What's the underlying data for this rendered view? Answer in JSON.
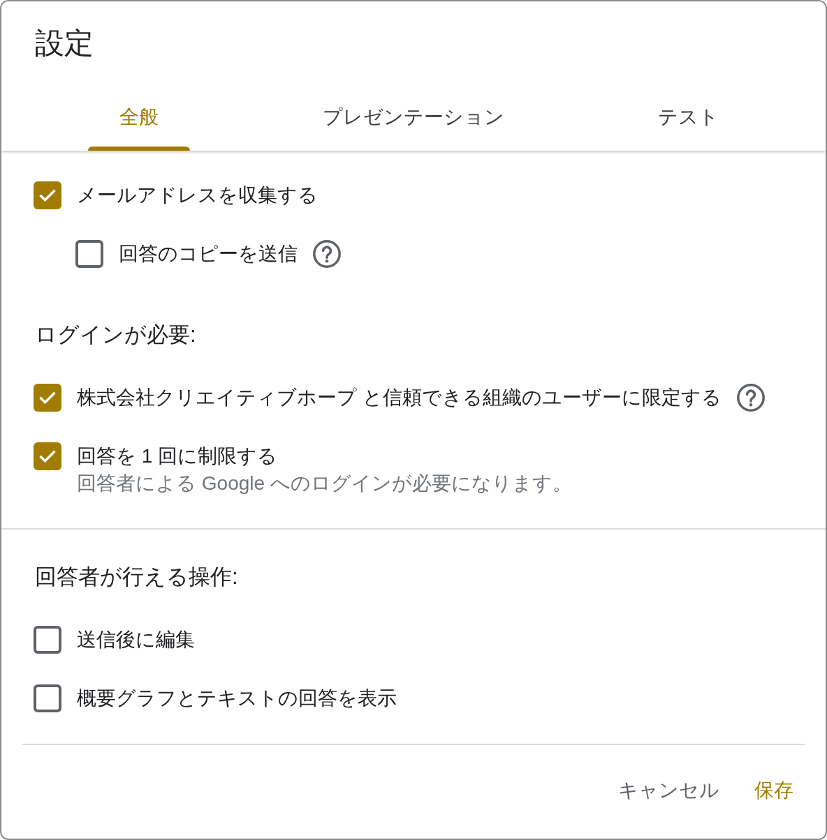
{
  "title": "設定",
  "tabs": [
    {
      "label": "全般",
      "selected": true
    },
    {
      "label": "プレゼンテーション",
      "selected": false
    },
    {
      "label": "テスト",
      "selected": false
    }
  ],
  "sections": [
    {
      "items": [
        {
          "kind": "checkbox",
          "label": "メールアドレスを収集する",
          "checked": true,
          "help": false,
          "children": [
            {
              "kind": "checkbox",
              "label": "回答のコピーを送信",
              "checked": false,
              "help": true
            }
          ]
        },
        {
          "kind": "heading",
          "label": "ログインが必要:"
        },
        {
          "kind": "checkbox",
          "label": "株式会社クリエイティブホープ と信頼できる組織のユーザーに限定する",
          "checked": true,
          "help": true
        },
        {
          "kind": "checkbox",
          "label": "回答を 1 回に制限する",
          "checked": true,
          "help": false,
          "description": "回答者による Google へのログインが必要になります。"
        }
      ]
    },
    {
      "items": [
        {
          "kind": "heading",
          "label": "回答者が行える操作:"
        },
        {
          "kind": "checkbox",
          "label": "送信後に編集",
          "checked": false,
          "help": false
        },
        {
          "kind": "checkbox",
          "label": "概要グラフとテキストの回答を表示",
          "checked": false,
          "help": false
        }
      ]
    }
  ],
  "buttons": [
    {
      "label": "キャンセル",
      "kind": "secondary"
    },
    {
      "label": "保存",
      "kind": "primary"
    }
  ]
}
